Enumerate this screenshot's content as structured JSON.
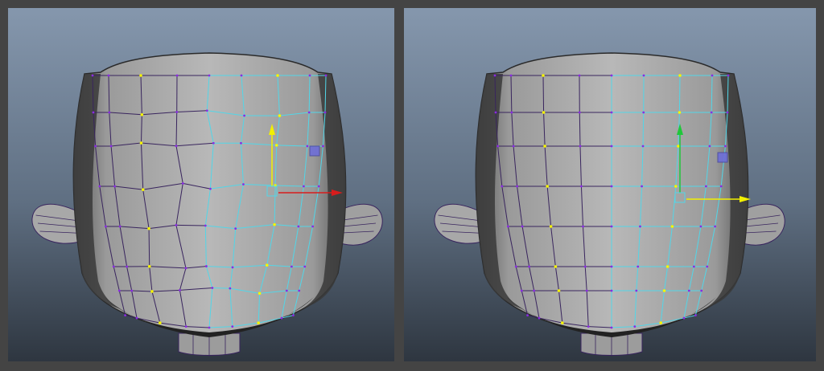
{
  "viewports": [
    {
      "id": "left",
      "edge_color": "#39255e",
      "selected_edge_color": "#52d6e8",
      "manip_up_color": "#f2f000",
      "manip_right_color": "#d81c1c",
      "mesh": "irregular"
    },
    {
      "id": "right",
      "edge_color": "#39255e",
      "selected_edge_color": "#52d6e8",
      "manip_up_color": "#1fc73a",
      "manip_right_color": "#f2f000",
      "mesh": "regular"
    }
  ],
  "colors": {
    "background": "#444444",
    "vertex": "#8a2be2",
    "vertex_selected": "#f5f500",
    "skin_light": "#b8b8b8",
    "skin_dark": "#3a3a3a"
  }
}
